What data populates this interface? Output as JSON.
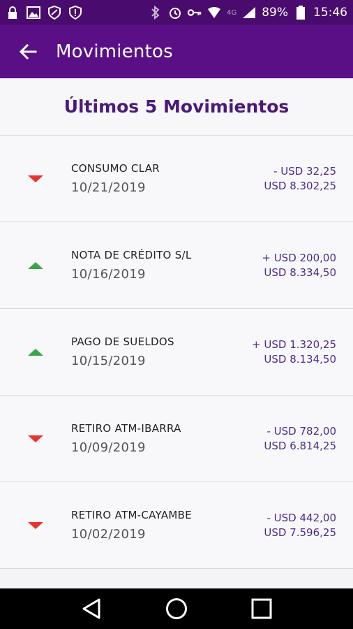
{
  "status": {
    "battery": "89%",
    "time": "15:46",
    "network": "4G"
  },
  "header": {
    "title": "Movimientos"
  },
  "section": {
    "title": "Últimos 5 Movimientos"
  },
  "movements": [
    {
      "description": "CONSUMO CLAR",
      "date": "10/21/2019",
      "amount": "- USD 32,25",
      "balance": "USD 8.302,25",
      "direction": "down"
    },
    {
      "description": "NOTA DE CRÉDITO S/L",
      "date": "10/16/2019",
      "amount": "+ USD 200,00",
      "balance": "USD 8.334,50",
      "direction": "up"
    },
    {
      "description": "PAGO DE SUELDOS",
      "date": "10/15/2019",
      "amount": "+ USD 1.320,25",
      "balance": "USD 8.134,50",
      "direction": "up"
    },
    {
      "description": "RETIRO ATM-IBARRA",
      "date": "10/09/2019",
      "amount": "- USD 782,00",
      "balance": "USD 6.814,25",
      "direction": "down"
    },
    {
      "description": "RETIRO ATM-CAYAMBE",
      "date": "10/02/2019",
      "amount": "- USD 442,00",
      "balance": "USD 7.596,25",
      "direction": "down"
    }
  ],
  "colors": {
    "brand": "#5a0f87",
    "statusbar": "#4a0b6e",
    "debit": "#e8352b",
    "credit": "#3aa54a",
    "amount_text": "#4c2a8c"
  }
}
